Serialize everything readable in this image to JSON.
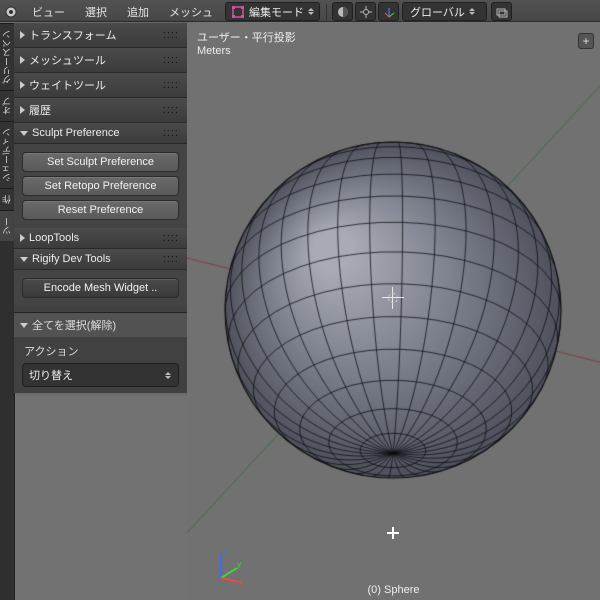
{
  "header": {
    "menus": [
      "ビュー",
      "選択",
      "追加",
      "メッシュ"
    ],
    "mode": "編集モード",
    "orientation": "グローバル"
  },
  "vtabs": [
    "グリースペン",
    "オプ",
    "シェーディン",
    "作"
  ],
  "panel": {
    "sections": [
      {
        "label": "トランスフォーム",
        "open": false
      },
      {
        "label": "メッシュツール",
        "open": false
      },
      {
        "label": "ウェイトツール",
        "open": false
      },
      {
        "label": "履歴",
        "open": false
      },
      {
        "label": "Sculpt Preference",
        "open": true,
        "buttons": [
          "Set Sculpt Preference",
          "Set Retopo Preference",
          "Reset Preference"
        ]
      },
      {
        "label": "LoopTools",
        "open": false
      },
      {
        "label": "Rigify Dev Tools",
        "open": true,
        "buttons": [
          "Encode Mesh Widget .."
        ]
      }
    ],
    "operator": {
      "header": "全てを選択(解除)",
      "action_label": "アクション",
      "action_value": "切り替え"
    }
  },
  "viewport": {
    "title": "ユーザー・平行投影",
    "units": "Meters",
    "object": "(0) Sphere",
    "axes": {
      "x": "x",
      "y": "y",
      "z": "z"
    }
  }
}
